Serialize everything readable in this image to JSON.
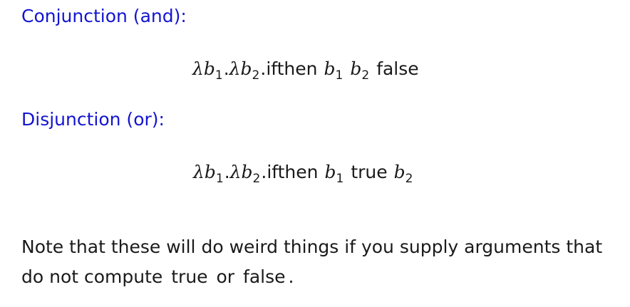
{
  "conjunction": {
    "heading": "Conjunction (and):",
    "formula": {
      "lambda1": "λ",
      "var1": "b",
      "sub1": "1",
      "dot1": ".",
      "lambda2": "λ",
      "var2": "b",
      "sub2": "2",
      "dot2": ".",
      "keyword": "ifthen",
      "arg1_var": "b",
      "arg1_sub": "1",
      "arg2_var": "b",
      "arg2_sub": "2",
      "arg3": "false"
    }
  },
  "disjunction": {
    "heading": "Disjunction (or):",
    "formula": {
      "lambda1": "λ",
      "var1": "b",
      "sub1": "1",
      "dot1": ".",
      "lambda2": "λ",
      "var2": "b",
      "sub2": "2",
      "dot2": ".",
      "keyword": "ifthen",
      "arg1_var": "b",
      "arg1_sub": "1",
      "arg2": "true",
      "arg3_var": "b",
      "arg3_sub": "2"
    }
  },
  "note": {
    "text_before": "Note that these will do weird things if you supply arguments that do not compute",
    "code1": "true",
    "text_middle": "or",
    "code2": "false",
    "text_after": "."
  }
}
